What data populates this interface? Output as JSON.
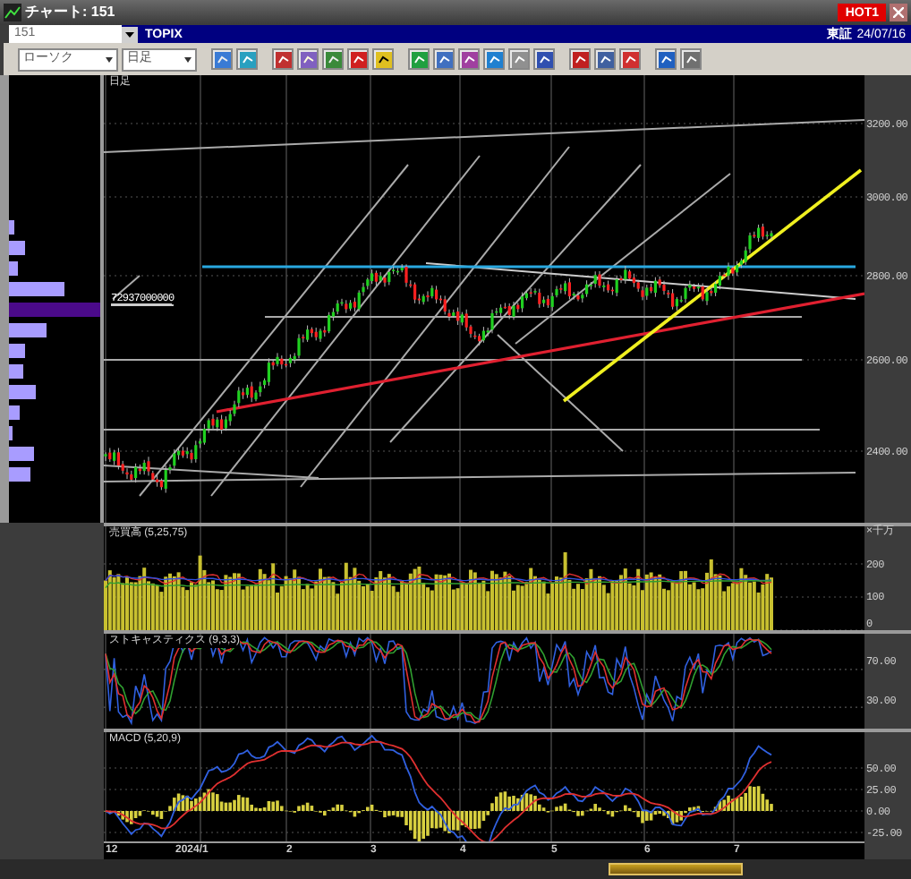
{
  "window": {
    "title": "チャート: 151",
    "badge": "HOT1"
  },
  "symbol_bar": {
    "code": "151",
    "name": "TOPIX",
    "market": "東証",
    "date": "24/07/16"
  },
  "toolbar": {
    "chart_type": "ローソク",
    "period": "日足"
  },
  "price_panel": {
    "label": "日足",
    "marker": "72937000000",
    "yticks": [
      "3200.00",
      "3000.00",
      "2800.00",
      "2600.00",
      "2400.00"
    ]
  },
  "volume_panel": {
    "label": "売買高 (5,25,75)",
    "unit": "×千万",
    "yticks": [
      "200",
      "100",
      "0"
    ]
  },
  "stochastics_panel": {
    "label": "ストキャスティクス (9,3,3)",
    "yticks": [
      "70.00",
      "30.00"
    ]
  },
  "macd_panel": {
    "label": "MACD (5,20,9)",
    "yticks": [
      "50.00",
      "25.00",
      "0.00",
      "-25.00"
    ]
  },
  "x_axis": [
    "12",
    "2024/1",
    "2",
    "3",
    "4",
    "5",
    "6",
    "7"
  ]
}
